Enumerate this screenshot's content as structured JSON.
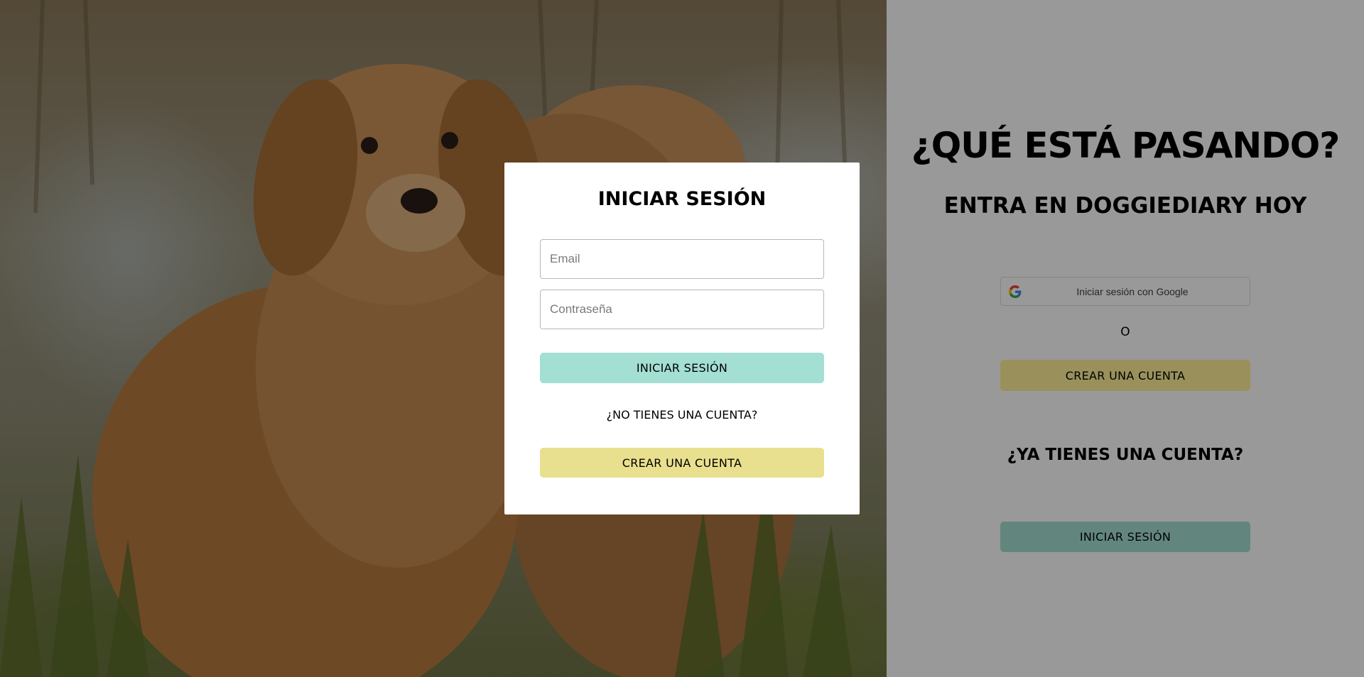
{
  "hero": {
    "image": "golden-retrievers-photo"
  },
  "aside": {
    "title": "¿QUÉ ESTÁ PASANDO?",
    "subtitle": "ENTRA EN DOGGIEDIARY HOY",
    "google_label": "Iniciar sesión con Google",
    "or_text": "O",
    "create_label": "CREAR UNA CUENTA",
    "have_account": "¿YA TIENES UNA CUENTA?",
    "login_label": "INICIAR SESIÓN"
  },
  "modal": {
    "title": "INICIAR SESIÓN",
    "email_placeholder": "Email",
    "email_value": "",
    "password_placeholder": "Contraseña",
    "password_value": "",
    "login_label": "INICIAR SESIÓN",
    "no_account": "¿NO TIENES UNA CUENTA?",
    "create_label": "CREAR UNA CUENTA"
  },
  "colors": {
    "teal": "#a3dfd3",
    "yellow": "#e8e08e",
    "overlay": "rgba(0,0,0,0.40)"
  },
  "icons": {
    "google": "google-g-icon"
  }
}
